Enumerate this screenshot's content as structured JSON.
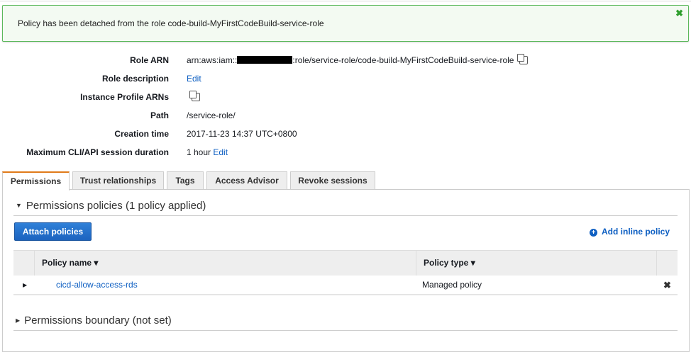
{
  "alert": {
    "message": "Policy has been detached from the role code-build-MyFirstCodeBuild-service-role",
    "close": "✖"
  },
  "summary": {
    "role_arn": {
      "label": "Role ARN",
      "prefix": "arn:aws:iam::",
      "suffix": ":role/service-role/code-build-MyFirstCodeBuild-service-role"
    },
    "role_description": {
      "label": "Role description",
      "link": "Edit"
    },
    "instance_profile": {
      "label": "Instance Profile ARNs"
    },
    "path": {
      "label": "Path",
      "value": "/service-role/"
    },
    "creation_time": {
      "label": "Creation time",
      "value": "2017-11-23 14:37 UTC+0800"
    },
    "session_duration": {
      "label": "Maximum CLI/API session duration",
      "value": "1 hour",
      "link": "Edit"
    }
  },
  "tabs": [
    "Permissions",
    "Trust relationships",
    "Tags",
    "Access Advisor",
    "Revoke sessions"
  ],
  "permissions": {
    "section_title": "Permissions policies (1 policy applied)",
    "attach_button": "Attach policies",
    "add_inline": "Add inline policy",
    "columns": [
      "Policy name ▾",
      "Policy type ▾"
    ],
    "rows": [
      {
        "name": "cicd-allow-access-rds",
        "type": "Managed policy"
      }
    ],
    "boundary_title": "Permissions boundary (not set)"
  },
  "colors": {
    "accent": "#0e5fc2",
    "tab_active": "#e07b1a",
    "success": "#5cb85c"
  }
}
